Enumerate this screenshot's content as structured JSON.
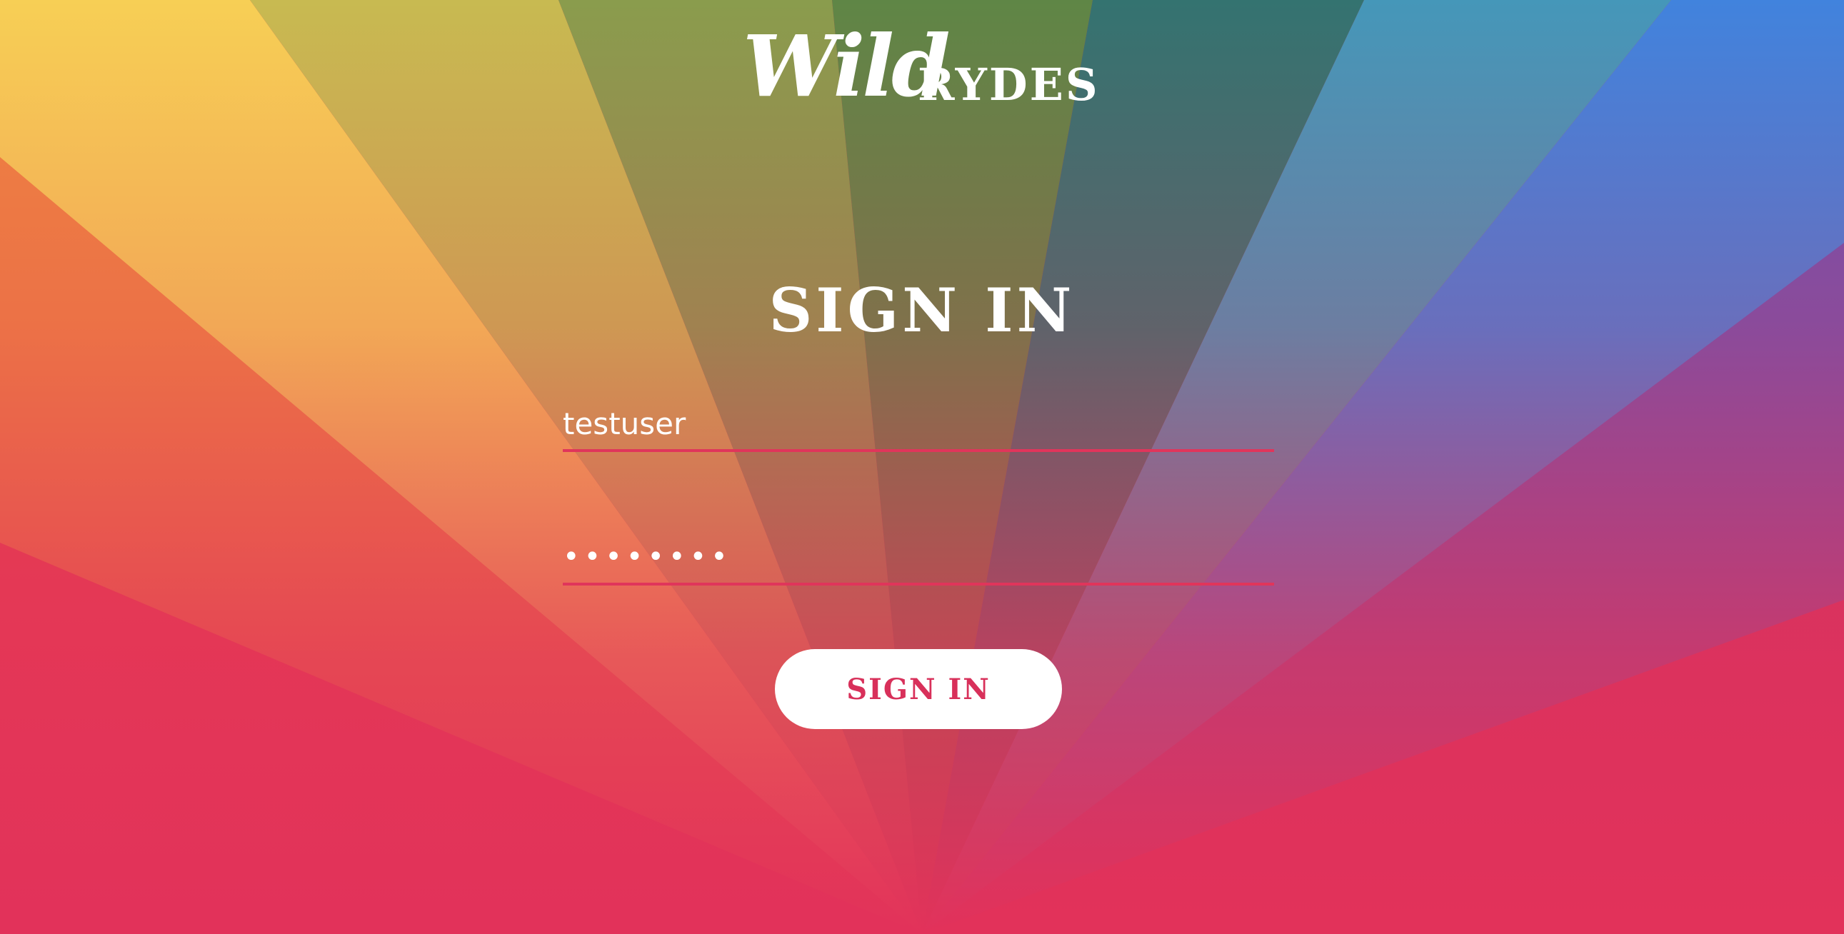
{
  "brand": {
    "logo_script": "Wild",
    "logo_caps": "RYDES"
  },
  "form": {
    "title": "SIGN IN",
    "username_value": "testuser",
    "password_value": "testpass",
    "submit_label": "SIGN IN"
  },
  "colors": {
    "accent": "#e0355b",
    "button_text": "#d8305a",
    "button_bg": "#ffffff",
    "background_bottom": "#e2325a"
  }
}
